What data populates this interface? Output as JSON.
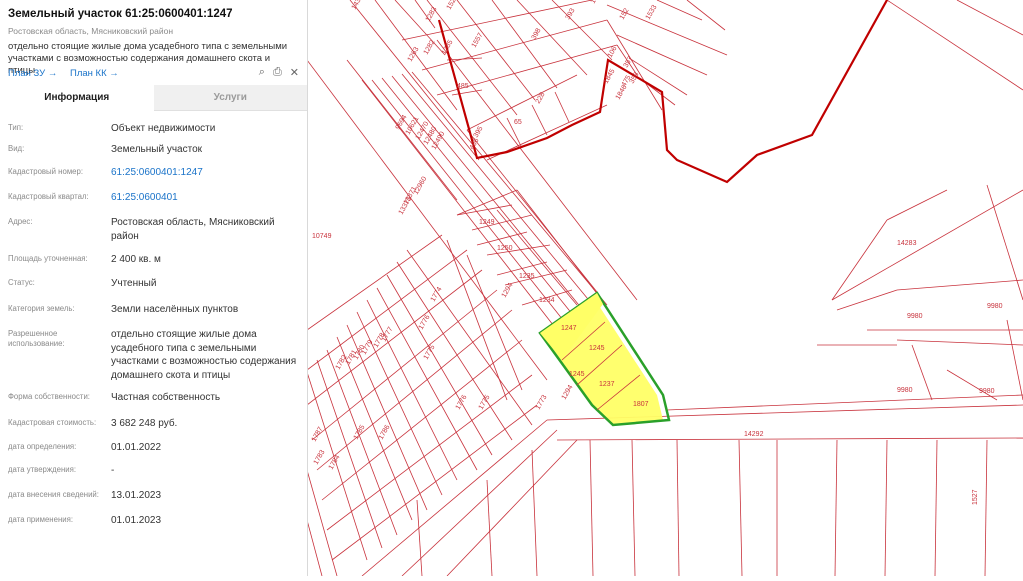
{
  "panel": {
    "title": "Земельный участок 61:25:0600401:1247",
    "subtitle": "Ростовская область, Мясниковский район",
    "description": "отдельно стоящие жилые дома усадебного типа с земельными участками с возможностью содержания домашнего скота и птицы",
    "links": {
      "plan_zu": "План ЗУ →",
      "plan_kk": "План КК →"
    },
    "icons": [
      "search-map-icon",
      "print-icon",
      "close-icon"
    ],
    "tabs": [
      {
        "label": "Информация",
        "active": true
      },
      {
        "label": "Услуги",
        "active": false
      }
    ],
    "rows": [
      {
        "label": "Тип:",
        "value": "Объект недвижимости"
      },
      {
        "label": "Вид:",
        "value": "Земельный участок"
      },
      {
        "label": "Кадастровый номер:",
        "value": "61:25:0600401:1247",
        "link": true
      },
      {
        "label": "Кадастровый квартал:",
        "value": "61:25:0600401",
        "link": true
      },
      {
        "label": "Адрес:",
        "value": "Ростовская область, Мясниковский район"
      },
      {
        "label": "Площадь уточненная:",
        "value": "2 400 кв. м"
      },
      {
        "label": "Статус:",
        "value": "Учтенный"
      },
      {
        "label": "Категория земель:",
        "value": "Земли населённых пунктов"
      },
      {
        "label": "Разрешенное использование:",
        "value": "отдельно стоящие жилые дома усадебного типа с земельными участками с возможностью содержания домашнего скота и птицы"
      },
      {
        "label": "Форма собственности:",
        "value": "Частная собственность"
      },
      {
        "label": "Кадастровая стоимость:",
        "value": "3 682 248 руб."
      },
      {
        "label": "дата определения:",
        "value": "01.01.2022"
      },
      {
        "label": "дата утверждения:",
        "value": "-"
      },
      {
        "label": "дата внесения сведений:",
        "value": "13.01.2023"
      },
      {
        "label": "дата применения:",
        "value": "01.01.2023"
      }
    ]
  },
  "map": {
    "colors": {
      "parcel_line": "#c8323c",
      "boundary": "#c00000",
      "highlight_fill": "#ffff66",
      "highlight_border": "#2aa02a",
      "label": "#c8323c"
    },
    "parcel_labels": [
      "1430",
      "1283",
      "1526",
      "393",
      "1551",
      "152",
      "1533",
      "1282",
      "1285",
      "1557",
      "398",
      "106",
      "357",
      "1263",
      "356",
      "485",
      "1846",
      "475",
      "1845",
      "395",
      "65",
      "228",
      "466",
      "9694",
      "10621",
      "12470",
      "12480",
      "12490",
      "12960",
      "13371",
      "13375",
      "10749",
      "1249",
      "1250",
      "1235",
      "1294",
      "1234",
      "1247",
      "1245",
      "1245",
      "1237",
      "1294",
      "1807",
      "1774",
      "1776",
      "1775",
      "1776",
      "1775",
      "1773",
      "1777",
      "1778",
      "1779",
      "1780",
      "1781",
      "1782",
      "1783",
      "1784",
      "1785",
      "1786",
      "1787",
      "14283",
      "9980",
      "9980",
      "9980",
      "9980",
      "14292",
      "1527"
    ]
  }
}
